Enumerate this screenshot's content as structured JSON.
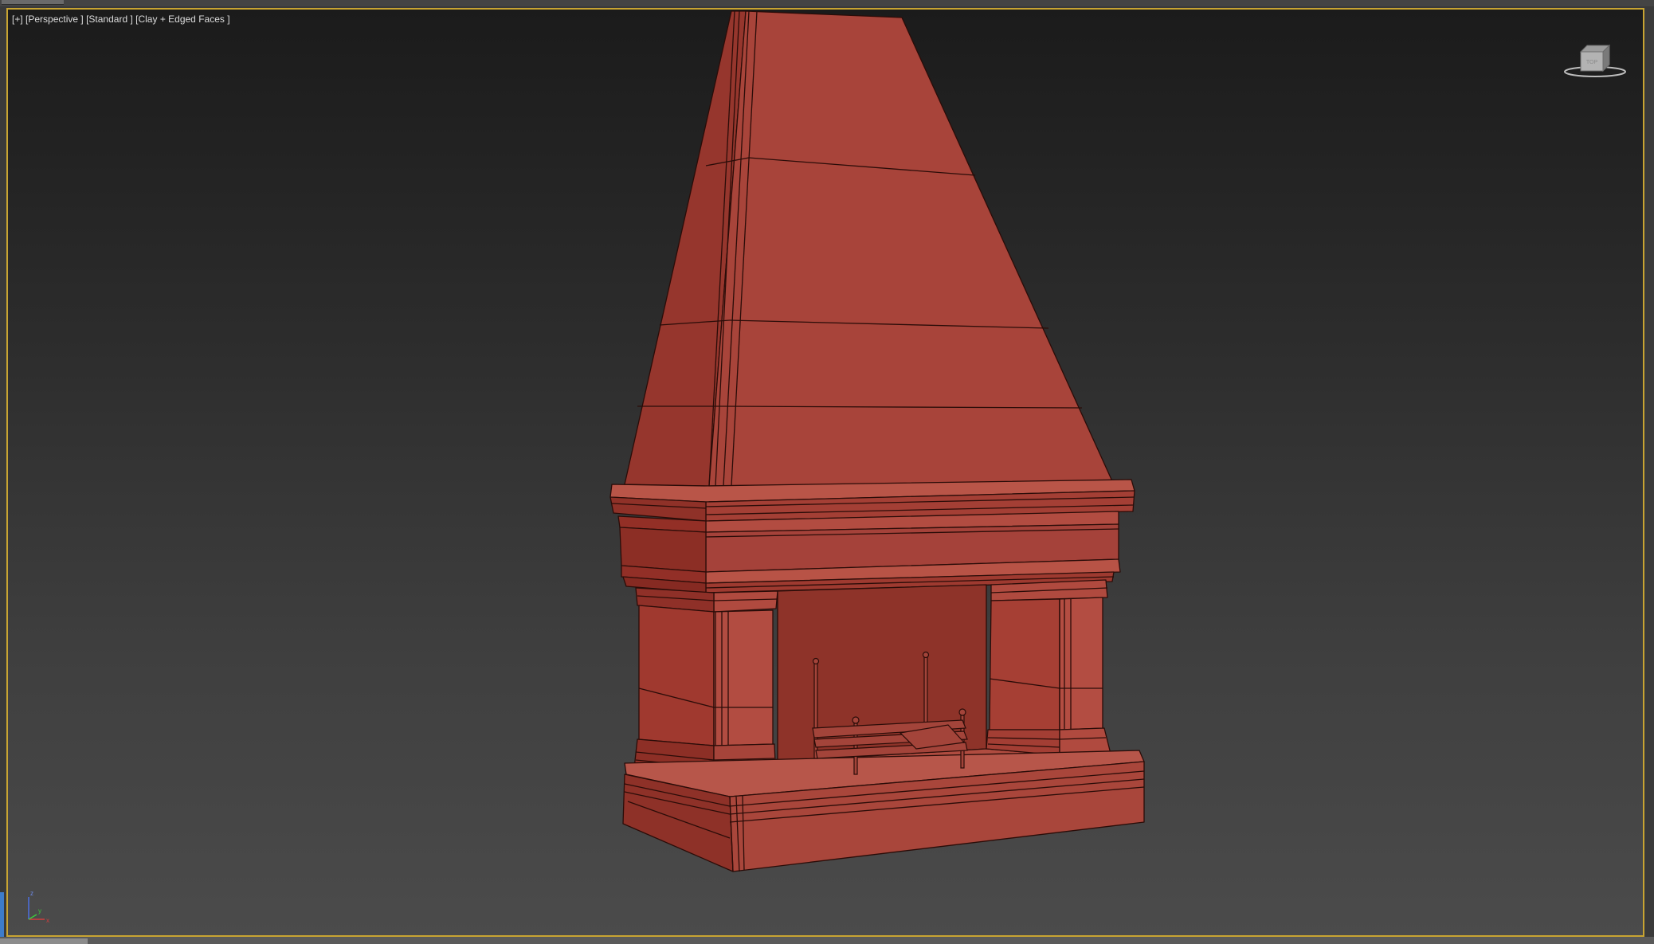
{
  "viewport": {
    "label_plus": "[+]",
    "label_view": "[Perspective ]",
    "label_shading": "[Standard ]",
    "label_mode": "[Clay + Edged Faces ]"
  },
  "viewcube": {
    "face_label": "TOP",
    "icon": "viewcube-icon"
  },
  "axis_gizmo": {
    "z_label": "z",
    "x_label": "x",
    "y_label": "y",
    "icon": "axis-tripod-icon"
  },
  "colors": {
    "viewport_border_active": "#c8a432",
    "clay": "#a8443a",
    "clay_dark": "#8f3128",
    "clay_light": "#b95548",
    "edge": "#2a0c08",
    "axis_x": "#d23c3c",
    "axis_y": "#3cc83c",
    "axis_z": "#4c6ee0"
  }
}
